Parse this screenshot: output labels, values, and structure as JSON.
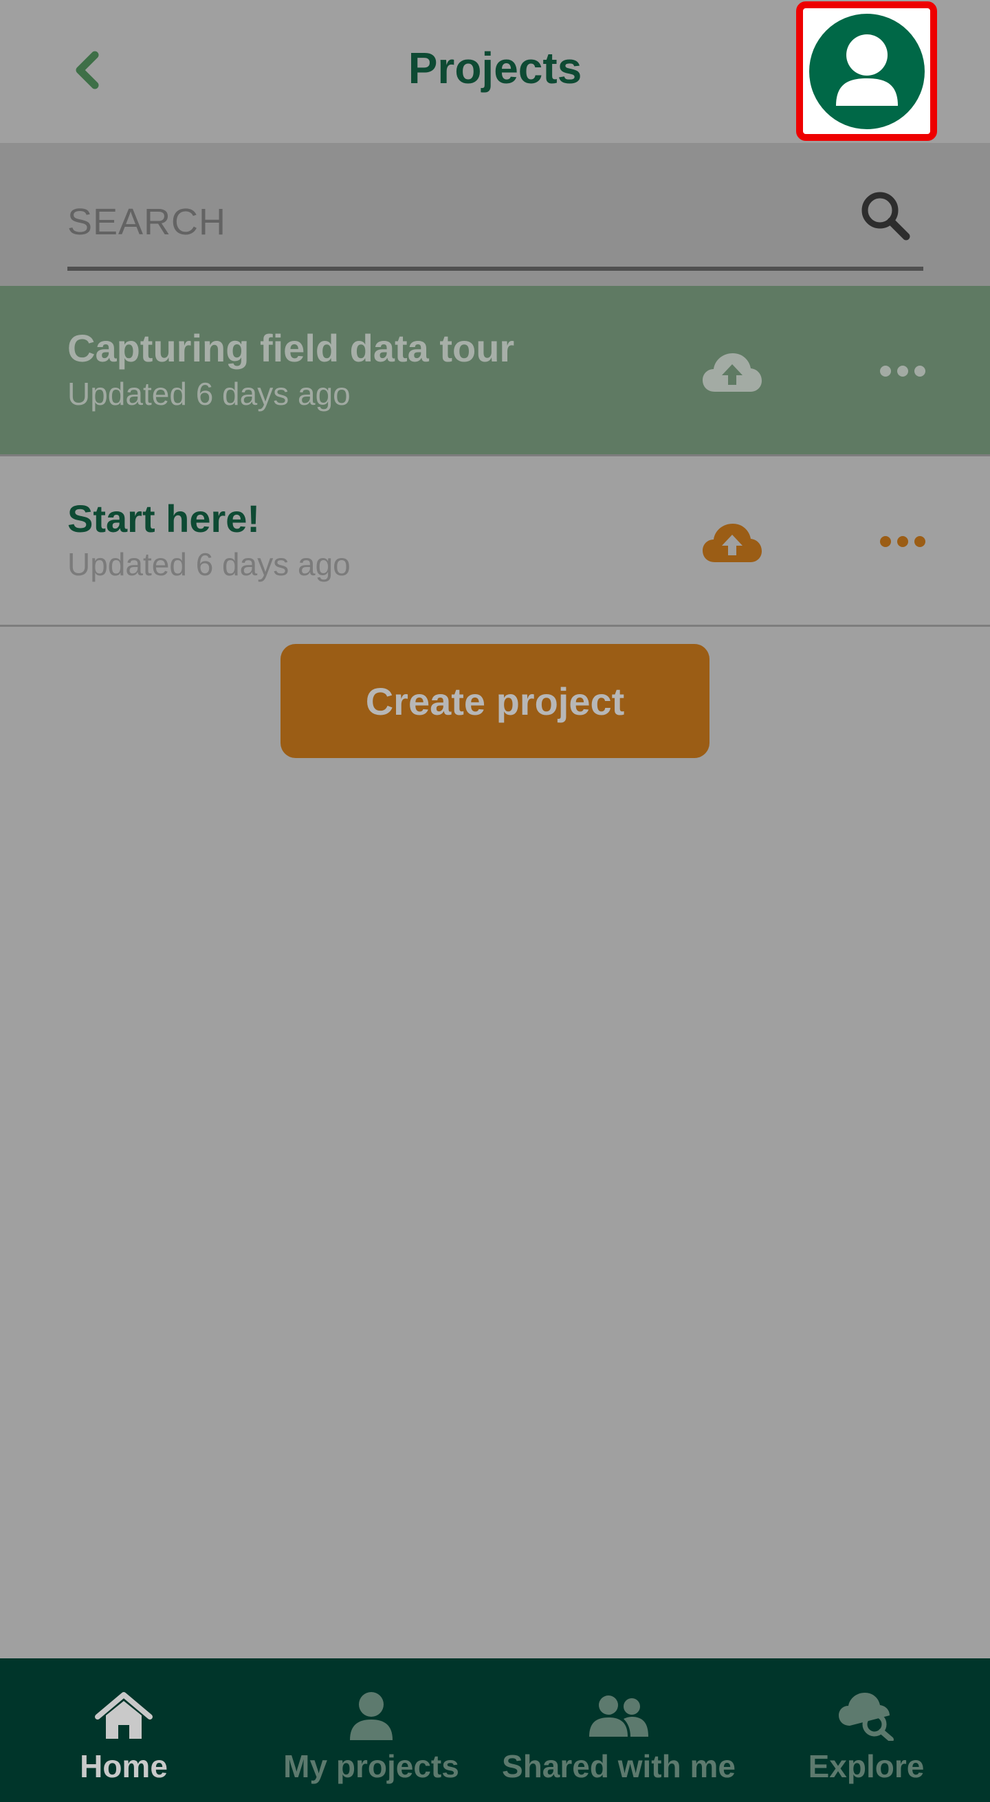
{
  "header": {
    "title": "Projects",
    "back_icon": "chevron-left-icon",
    "avatar_icon": "user-icon"
  },
  "search": {
    "placeholder": "SEARCH",
    "value": "",
    "icon": "search-icon"
  },
  "projects": [
    {
      "title": "Capturing field data tour",
      "updated": "Updated 6 days ago",
      "status_icon": "cloud-upload-icon",
      "menu_icon": "more-horizontal-icon"
    },
    {
      "title": "Start here!",
      "updated": "Updated 6 days ago",
      "status_icon": "cloud-upload-icon",
      "menu_icon": "more-horizontal-icon"
    }
  ],
  "create_button": {
    "label": "Create project"
  },
  "bottom_nav": [
    {
      "label": "Home",
      "icon": "home-icon",
      "active": true
    },
    {
      "label": "My projects",
      "icon": "person-icon",
      "active": false
    },
    {
      "label": "Shared with me",
      "icon": "people-icon",
      "active": false
    },
    {
      "label": "Explore",
      "icon": "cloud-search-icon",
      "active": false
    }
  ],
  "colors": {
    "brand_green": "#006847",
    "dark_green": "#00352a",
    "accent_orange": "#9b5d15",
    "highlight_red": "#ee0000"
  }
}
